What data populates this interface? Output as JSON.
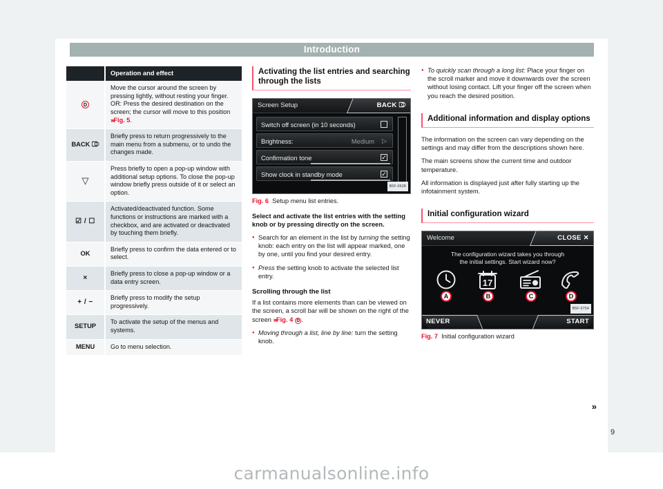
{
  "header": {
    "title": "Introduction"
  },
  "page_number": "9",
  "watermark": "carmanualsonline.info",
  "table": {
    "columns": [
      "",
      "Operation and effect"
    ],
    "rows": [
      {
        "symbol_type": "circle-letter",
        "symbol": "D",
        "text": "Move the cursor around the screen by pressing lightly, without resting your finger. OR: Press the desired destination on the screen; the cursor will move to this position ",
        "ref_chevron": "›››",
        "ref": "Fig. 5",
        "text_tail": "."
      },
      {
        "symbol_type": "text-icon",
        "symbol": "BACK",
        "symbol_icon": "back-arrow-icon",
        "text": "Briefly press to return progressively to the main menu from a submenu, or to undo the changes made."
      },
      {
        "symbol_type": "glyph",
        "symbol": "▽",
        "text": "Press briefly to open a pop-up window with additional setup options. To close the pop-up window briefly press outside of it or select an option."
      },
      {
        "symbol_type": "glyph",
        "symbol": "☑ / ☐",
        "text": "Activated/deactivated function. Some functions or instructions are marked with a checkbox, and are activated or deactivated by touching them briefly."
      },
      {
        "symbol_type": "text",
        "symbol": "OK",
        "text": "Briefly press to confirm the data entered or to select."
      },
      {
        "symbol_type": "glyph",
        "symbol": "×",
        "text": "Briefly press to close a pop-up window or a data entry screen."
      },
      {
        "symbol_type": "glyph",
        "symbol": "+ / −",
        "text": "Briefly press to modify the setup progressively."
      },
      {
        "symbol_type": "text",
        "symbol": "SETUP",
        "text": "To activate the setup of the menus and systems."
      },
      {
        "symbol_type": "text",
        "symbol": "MENU",
        "text": "Go to menu selection."
      }
    ]
  },
  "col2": {
    "heading": "Activating the list entries and searching through the lists",
    "figure": {
      "caption_num": "Fig. 6",
      "caption_text": "Setup menu list entries.",
      "code": "B5F-0628",
      "screen_title": "Screen Setup",
      "back_label": "BACK",
      "rows": [
        {
          "label": "Switch off screen (in 10 seconds)",
          "control": "checkbox-empty",
          "value": ""
        },
        {
          "label": "Brightness:",
          "control": "value-arrow",
          "value": "Medium"
        },
        {
          "label": "Confirmation tone",
          "control": "checkbox-checked",
          "value": ""
        },
        {
          "label": "Show clock in standby mode",
          "control": "checkbox-checked",
          "value": ""
        }
      ]
    },
    "lead": "Select and activate the list entries with the setting knob or by pressing directly on the screen.",
    "bullet1_pre": "Search for an element in the list by ",
    "bullet1_it": "turning",
    "bullet1_post": " the setting knob: each entry on the list will appear marked, one by one, until you find your desired entry.",
    "bullet2_it": "Press",
    "bullet2_post": " the setting knob to activate the selected list entry.",
    "subhead": "Scrolling through the list",
    "para1_pre": "If a list contains more elements than can be viewed on the screen, a scroll bar will be shown on the right of the screen ",
    "para1_chev": "›››",
    "para1_ref": "Fig. 4",
    "para1_badge": "D",
    "para1_post": ".",
    "bullet3_it": "Moving through a list, line by line:",
    "bullet3_post": " turn the setting knob."
  },
  "col3": {
    "bullet1_it": "To quickly scan through a long list:",
    "bullet1_post": " Place your finger on the scroll marker and move it downwards over the screen without losing contact. Lift your finger off the screen when you reach the desired position.",
    "heading1": "Additional information and display options",
    "para1": "The information on the screen can vary depending on the settings and may differ from the descriptions shown here.",
    "para2": "The main screens show the current time and outdoor temperature.",
    "para3": "All information is displayed just after fully starting up the infotainment system.",
    "heading2": "Initial configuration wizard",
    "figure": {
      "caption_num": "Fig. 7",
      "caption_text": "Initial configuration wizard",
      "code": "B5F-0754",
      "screen_title": "Welcome",
      "close_label": "CLOSE",
      "message_line1": "The configuration wizard takes you through",
      "message_line2": "the initial settings. Start wizard now?",
      "icons": [
        {
          "badge": "A",
          "icon": "clock-icon"
        },
        {
          "badge": "B",
          "icon": "calendar-icon",
          "day": "17"
        },
        {
          "badge": "C",
          "icon": "radio-icon"
        },
        {
          "badge": "D",
          "icon": "phone-icon"
        }
      ],
      "never_label": "NEVER",
      "start_label": "START"
    },
    "continue_arrow": "»"
  },
  "colors": {
    "accent_red": "#e8112d",
    "heading_rule": "#ff4d6a",
    "header_bar": "#a3b1b0",
    "table_header_bg": "#1d2326",
    "row_odd": "#f4f6f7",
    "row_even": "#dfe5e8"
  }
}
